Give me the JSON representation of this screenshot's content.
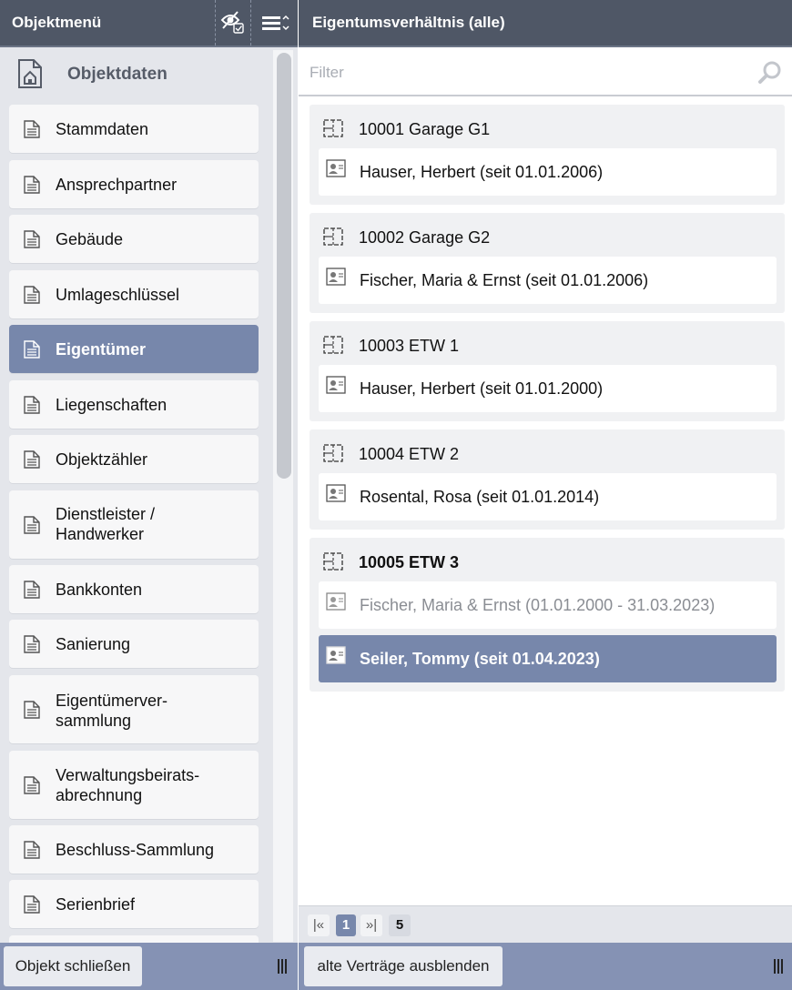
{
  "left_panel": {
    "title": "Objektmenü",
    "section_title": "Objektdaten",
    "menu_items": [
      {
        "label": "Stammdaten"
      },
      {
        "label": "Ansprechpartner"
      },
      {
        "label": "Gebäude"
      },
      {
        "label": "Umlageschlüssel"
      },
      {
        "label": "Eigentümer",
        "active": true
      },
      {
        "label": "Liegenschaften"
      },
      {
        "label": "Objektzähler"
      },
      {
        "label_line1": "Dienstleister /",
        "label_line2": "Handwerker"
      },
      {
        "label": "Bankkonten"
      },
      {
        "label": "Sanierung"
      },
      {
        "label_line1": "Eigentümerver-",
        "label_line2": "sammlung"
      },
      {
        "label_line1": "Verwaltungsbeirats-",
        "label_line2": "abrechnung"
      },
      {
        "label": "Beschluss-Sammlung"
      },
      {
        "label": "Serienbrief"
      }
    ],
    "footer_button": "Objekt schließen"
  },
  "right_panel": {
    "title": "Eigentumsverhältnis (alle)",
    "filter_placeholder": "Filter",
    "groups": [
      {
        "unit": "10001 Garage G1",
        "owners": [
          {
            "text": "Hauser, Herbert (seit 01.01.2006)"
          }
        ]
      },
      {
        "unit": "10002 Garage G2",
        "owners": [
          {
            "text": "Fischer, Maria & Ernst (seit 01.01.2006)"
          }
        ]
      },
      {
        "unit": "10003 ETW 1",
        "owners": [
          {
            "text": "Hauser, Herbert (seit 01.01.2000)"
          }
        ]
      },
      {
        "unit": "10004 ETW 2",
        "owners": [
          {
            "text": "Rosental, Rosa (seit 01.01.2014)"
          }
        ]
      },
      {
        "unit": "10005 ETW 3",
        "owners": [
          {
            "text": "Fischer, Maria & Ernst (01.01.2000 - 31.03.2023)",
            "state": "former"
          },
          {
            "text": "Seiler, Tommy (seit 01.04.2023)",
            "state": "selected"
          }
        ]
      }
    ],
    "pager": {
      "first": "|«",
      "current_page": "1",
      "last": "»|",
      "total": "5"
    },
    "footer_button": "alte Verträge ausblenden"
  },
  "colors": {
    "header_bg": "#4f5766",
    "accent": "#7787ab",
    "footer_bg": "#8592b4"
  },
  "icons": {
    "header_left": [
      "visibility-toggle-icon",
      "list-menu-icon"
    ],
    "section": "house-document-icon",
    "menu_item": "document-icon",
    "unit": "floorplan-icon",
    "owner": "contact-card-icon",
    "filter": "search-icon",
    "footer": "grip-icon"
  }
}
